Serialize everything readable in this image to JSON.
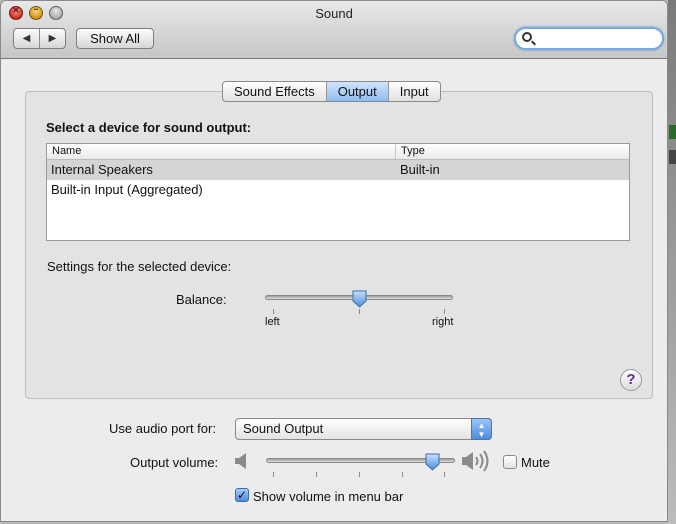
{
  "window": {
    "title": "Sound"
  },
  "toolbar": {
    "back_label": "◀",
    "forward_label": "▶",
    "show_all_label": "Show All",
    "search_placeholder": ""
  },
  "tabs": [
    {
      "label": "Sound Effects",
      "active": false
    },
    {
      "label": "Output",
      "active": true
    },
    {
      "label": "Input",
      "active": false
    }
  ],
  "output": {
    "device_heading": "Select a device for sound output:",
    "columns": {
      "name": "Name",
      "type": "Type"
    },
    "devices": [
      {
        "name": "Internal Speakers",
        "type": "Built-in",
        "selected": true
      },
      {
        "name": "Built-in Input (Aggregated)",
        "type": "",
        "selected": false
      }
    ],
    "settings_heading": "Settings for the selected device:",
    "balance": {
      "label": "Balance:",
      "left_label": "left",
      "right_label": "right",
      "value": 0.5
    }
  },
  "help_label": "?",
  "audio_port": {
    "label": "Use audio port for:",
    "selected": "Sound Output"
  },
  "volume": {
    "label": "Output volume:",
    "value": 0.9,
    "mute_label": "Mute",
    "muted": false
  },
  "menu_bar": {
    "label": "Show volume in menu bar",
    "checked": true
  },
  "colors": {
    "accent": "#4a8de0",
    "selection": "#d4d4d4"
  }
}
